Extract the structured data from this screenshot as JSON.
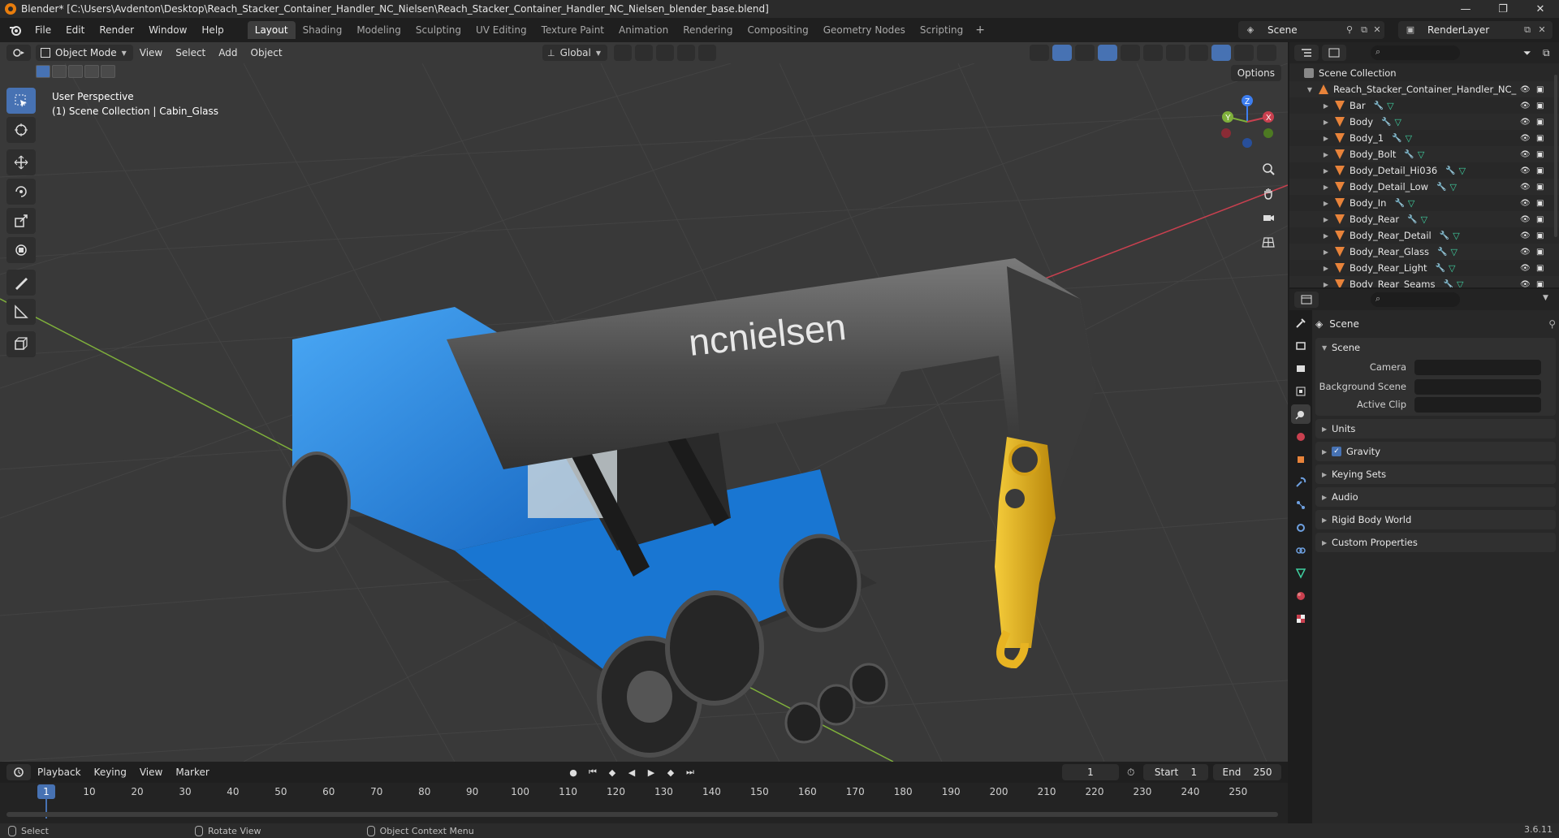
{
  "window": {
    "title": "Blender* [C:\\Users\\Avdenton\\Desktop\\Reach_Stacker_Container_Handler_NC_Nielsen\\Reach_Stacker_Container_Handler_NC_Nielsen_blender_base.blend]",
    "minimize": "—",
    "maximize": "❐",
    "close": "✕"
  },
  "menu": [
    "File",
    "Edit",
    "Render",
    "Window",
    "Help"
  ],
  "workspaces": [
    "Layout",
    "Shading",
    "Modeling",
    "Sculpting",
    "UV Editing",
    "Texture Paint",
    "Animation",
    "Rendering",
    "Compositing",
    "Geometry Nodes",
    "Scripting"
  ],
  "workspace_add": "+",
  "scene_name": "Scene",
  "render_layer": "RenderLayer",
  "viewport": {
    "mode": "Object Mode",
    "menus": [
      "View",
      "Select",
      "Add",
      "Object"
    ],
    "orientation": "Global",
    "options_label": "Options",
    "info_line1": "User Perspective",
    "info_line2": "(1) Scene Collection | Cabin_Glass",
    "logo_text": "ncnielsen",
    "axes": {
      "x": "X",
      "y": "Y",
      "z": "Z"
    }
  },
  "timeline": {
    "menus": [
      "Playback",
      "Keying",
      "View",
      "Marker"
    ],
    "current_frame": "1",
    "start_label": "Start",
    "start_value": "1",
    "end_label": "End",
    "end_value": "250",
    "ticks": [
      "1",
      "10",
      "20",
      "30",
      "40",
      "50",
      "60",
      "70",
      "80",
      "90",
      "100",
      "110",
      "120",
      "130",
      "140",
      "150",
      "160",
      "170",
      "180",
      "190",
      "200",
      "210",
      "220",
      "230",
      "240",
      "250"
    ]
  },
  "status": {
    "select": "Select",
    "rotate": "Rotate View",
    "context": "Object Context Menu",
    "version": "3.6.11"
  },
  "outliner": {
    "root": "Scene Collection",
    "collection": "Reach_Stacker_Container_Handler_NC_",
    "items": [
      "Bar",
      "Body",
      "Body_1",
      "Body_Bolt",
      "Body_Detail_Hi036",
      "Body_Detail_Low",
      "Body_In",
      "Body_Rear",
      "Body_Rear_Detail",
      "Body_Rear_Glass",
      "Body_Rear_Light",
      "Body_Rear_Seams"
    ]
  },
  "properties": {
    "context_title": "Scene",
    "panel_scene": "Scene",
    "camera_label": "Camera",
    "background_label": "Background Scene",
    "clip_label": "Active Clip",
    "panels": [
      "Units",
      "Gravity",
      "Keying Sets",
      "Audio",
      "Rigid Body World",
      "Custom Properties"
    ]
  },
  "colors": {
    "accent": "#4772b3",
    "machine_blue": "#1e88e5",
    "hook_yellow": "#e8b422",
    "boom_gray": "#4a4a4a",
    "grid": "#444444",
    "x_axis": "#c9404f",
    "y_axis": "#7fb03b",
    "z_axis": "#3d7ef0"
  }
}
